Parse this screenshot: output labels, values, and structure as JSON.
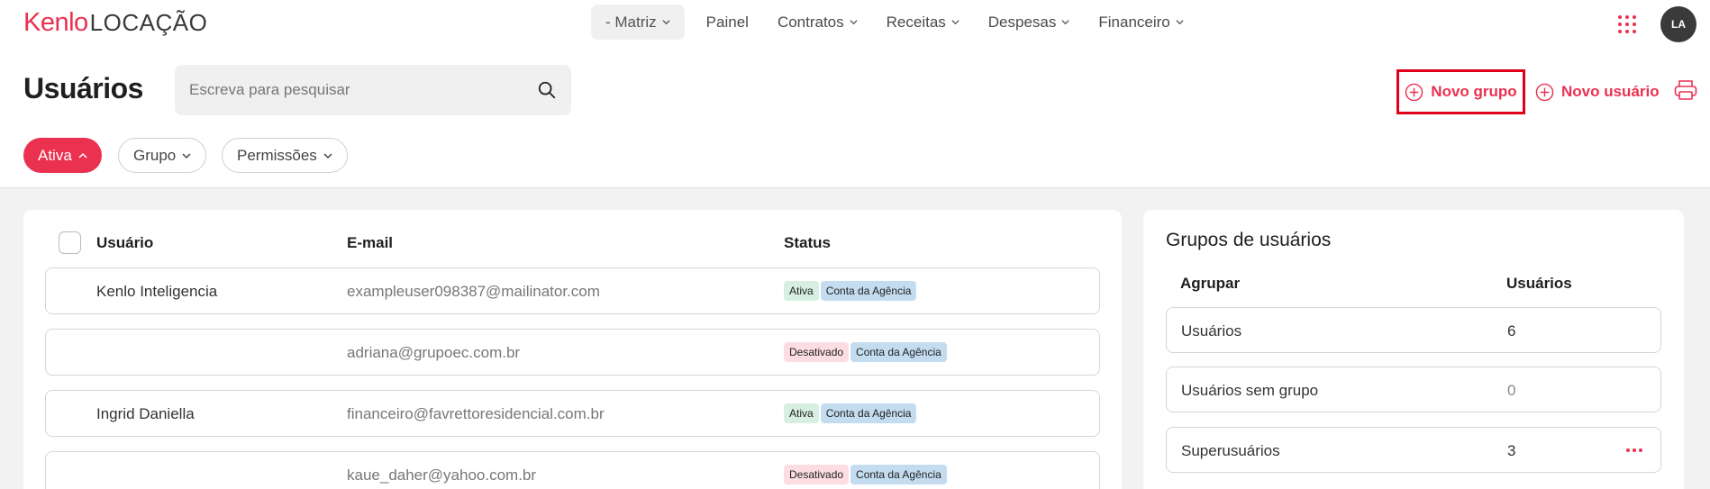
{
  "brand": {
    "name": "Kenlo",
    "product": "LOCAÇÃO",
    "accent": "#ea3150"
  },
  "nav": {
    "unit": "- Matriz",
    "items": [
      {
        "label": "Painel",
        "has_dropdown": false
      },
      {
        "label": "Contratos",
        "has_dropdown": true
      },
      {
        "label": "Receitas",
        "has_dropdown": true
      },
      {
        "label": "Despesas",
        "has_dropdown": true
      },
      {
        "label": "Financeiro",
        "has_dropdown": true
      }
    ],
    "apps_icon": "grid-dots-icon",
    "avatar_initials": "LA"
  },
  "header": {
    "title": "Usuários",
    "search_placeholder": "Escreva para pesquisar",
    "new_group_label": "Novo grupo",
    "new_user_label": "Novo usuário",
    "print_icon": "printer-icon"
  },
  "filters": [
    {
      "label": "Ativa",
      "active": true
    },
    {
      "label": "Grupo",
      "active": false
    },
    {
      "label": "Permissões",
      "active": false
    }
  ],
  "users_table": {
    "columns": {
      "user": "Usuário",
      "email": "E-mail",
      "status": "Status"
    },
    "rows": [
      {
        "name": "Kenlo Inteligencia",
        "email": "exampleuser098387@mailinator.com",
        "status": "Ativa",
        "type": "Conta da Agência"
      },
      {
        "name": "",
        "email": "adriana@grupoec.com.br",
        "status": "Desativado",
        "type": "Conta da Agência"
      },
      {
        "name": "Ingrid Daniella",
        "email": "financeiro@favrettoresidencial.com.br",
        "status": "Ativa",
        "type": "Conta da Agência"
      },
      {
        "name": "",
        "email": "kaue_daher@yahoo.com.br",
        "status": "Desativado",
        "type": "Conta da Agência"
      }
    ]
  },
  "groups": {
    "title": "Grupos de usuários",
    "columns": {
      "group": "Agrupar",
      "users": "Usuários"
    },
    "rows": [
      {
        "name": "Usuários",
        "count": "6"
      },
      {
        "name": "Usuários sem grupo",
        "count": "0"
      },
      {
        "name": "Superusuários",
        "count": "3"
      }
    ]
  }
}
